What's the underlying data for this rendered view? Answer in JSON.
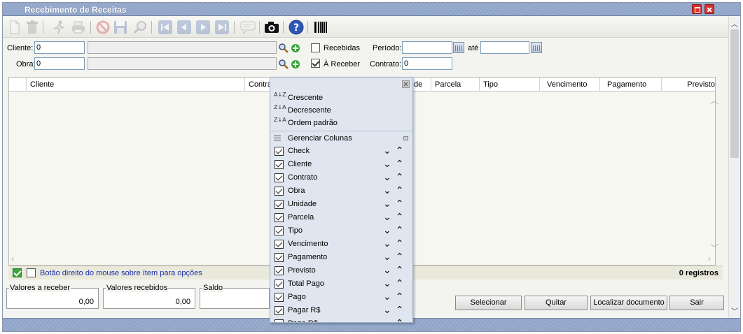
{
  "window": {
    "title": "Recebimento de Receitas"
  },
  "filters": {
    "cliente_label": "Cliente:",
    "cliente_code": "0",
    "cliente_name": "",
    "obra_label": "Obra:",
    "obra_code": "0",
    "obra_name": "",
    "recebidas_label": "Recebidas",
    "recebidas_checked": false,
    "a_receber_label": "À Receber",
    "a_receber_checked": true,
    "periodo_label": "Período:",
    "periodo_inicio": "",
    "ate_label": "até",
    "periodo_fim": "",
    "contrato_label": "Contrato:",
    "contrato_value": "0"
  },
  "grid": {
    "columns": [
      {
        "label": ""
      },
      {
        "label": "Cliente"
      },
      {
        "label": "Contrat"
      },
      {
        "label": "de"
      },
      {
        "label": "Parcela"
      },
      {
        "label": "Tipo"
      },
      {
        "label": "Vencimento"
      },
      {
        "label": "Pagamento"
      },
      {
        "label": "Previsto"
      }
    ],
    "hint": "Botão direito do mouse sobre ítem para opções",
    "count": "0 registros"
  },
  "totals": {
    "a_receber_label": "Valores a receber",
    "a_receber_value": "0,00",
    "recebidos_label": "Valores recebidos",
    "recebidos_value": "0,00",
    "saldo_label": "Saldo",
    "saldo_value": ""
  },
  "buttons": {
    "selecionar": "Selecionar",
    "quitar": "Quitar",
    "localizar": "Localizar documento",
    "sair": "Sair"
  },
  "context_menu": {
    "sort": [
      {
        "label": "Crescente",
        "icon": "A↓Z"
      },
      {
        "label": "Decrescente",
        "icon": "Z↓A"
      },
      {
        "label": "Ordem padrão",
        "icon": "Z↓A"
      }
    ],
    "manage_label": "Gerenciar Colunas",
    "columns": [
      {
        "label": "Check",
        "checked": true
      },
      {
        "label": "Cliente",
        "checked": true
      },
      {
        "label": "Contrato",
        "checked": true
      },
      {
        "label": "Obra",
        "checked": true
      },
      {
        "label": "Unidade",
        "checked": true
      },
      {
        "label": "Parcela",
        "checked": true
      },
      {
        "label": "Tipo",
        "checked": true
      },
      {
        "label": "Vencimento",
        "checked": true
      },
      {
        "label": "Pagamento",
        "checked": true
      },
      {
        "label": "Previsto",
        "checked": true
      },
      {
        "label": "Total Pago",
        "checked": true
      },
      {
        "label": "Pago",
        "checked": true
      },
      {
        "label": "Pagar R$",
        "checked": true
      },
      {
        "label": "Pago R$",
        "checked": true
      }
    ],
    "arrows": "⌄⌃"
  },
  "toolbar_icons": [
    "new-document-icon",
    "delete-icon",
    "run-icon",
    "print-icon",
    "cancel-icon",
    "save-icon",
    "search-icon",
    "first-record-icon",
    "previous-record-icon",
    "next-record-icon",
    "last-record-icon",
    "comment-icon",
    "camera-icon",
    "help-icon",
    "barcode-icon"
  ]
}
